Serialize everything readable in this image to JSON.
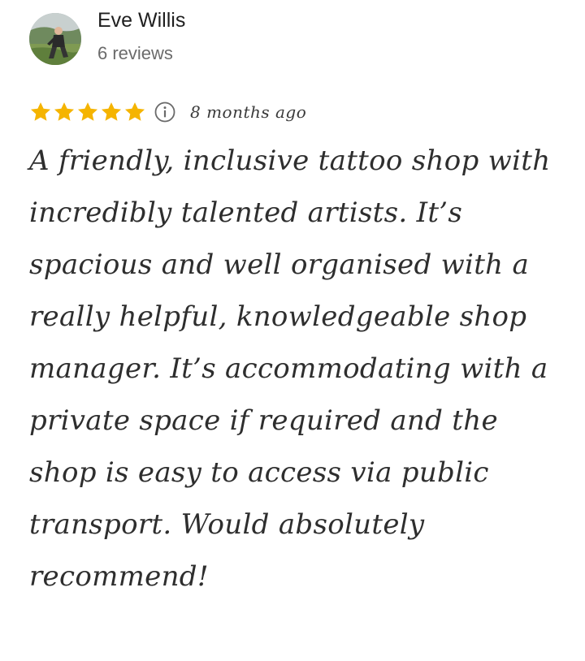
{
  "reviewer": {
    "name": "Eve Willis",
    "review_count": "6 reviews",
    "avatar_icon": "profile-photo"
  },
  "rating": {
    "stars": 5,
    "max_stars": 5,
    "star_color": "#F5B400",
    "info_icon": "info-icon",
    "time_ago": "8 months ago"
  },
  "review": {
    "text": "A friendly, inclusive tattoo shop with incredibly talented artists. It’s spacious and well organised with a really helpful, knowledgeable shop manager. It’s accommodating with a private space if required and the shop is easy to access via public transport. Would absolutely recommend!"
  }
}
